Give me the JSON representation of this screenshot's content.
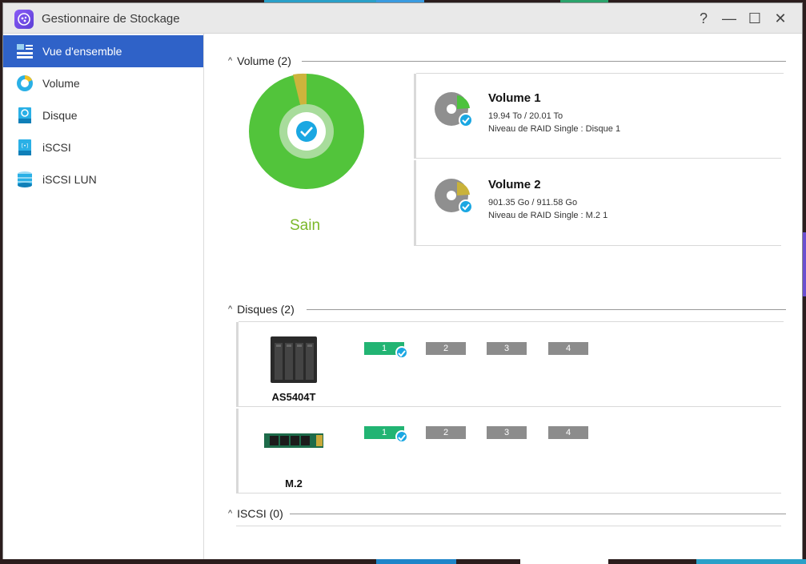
{
  "window": {
    "title": "Gestionnaire de Stockage"
  },
  "titlebar_controls": {
    "help": "?",
    "minimize": "—",
    "maximize": "☐",
    "close": "✕"
  },
  "sidebar": {
    "items": [
      {
        "label": "Vue d'ensemble",
        "icon": "overview-icon",
        "active": true
      },
      {
        "label": "Volume",
        "icon": "volume-icon",
        "active": false
      },
      {
        "label": "Disque",
        "icon": "disk-icon",
        "active": false
      },
      {
        "label": "iSCSI",
        "icon": "iscsi-icon",
        "active": false
      },
      {
        "label": "iSCSI LUN",
        "icon": "iscsi-lun-icon",
        "active": false
      }
    ]
  },
  "volume_section": {
    "title": "Volume (2)",
    "status": "Sain",
    "status_color": "#7bb82a",
    "volumes": [
      {
        "name": "Volume 1",
        "usage": "19.94 To / 20.01 To",
        "raid": "Niveau de RAID Single : Disque 1",
        "used_fraction": 0.9965,
        "pie_color": "#4cc23d"
      },
      {
        "name": "Volume 2",
        "usage": "901.35 Go / 911.58 Go",
        "raid": "Niveau de RAID Single : M.2 1",
        "used_fraction": 0.9888,
        "pie_color": "#c9b23a"
      }
    ]
  },
  "disks_section": {
    "title": "Disques (2)",
    "devices": [
      {
        "name": "AS5404T",
        "bays": [
          "1",
          "2",
          "3",
          "4"
        ],
        "healthy_bay": "1"
      },
      {
        "name": "M.2",
        "bays": [
          "1",
          "2",
          "3",
          "4"
        ],
        "healthy_bay": "1"
      }
    ]
  },
  "iscsi_section": {
    "title": "ISCSI (0)"
  },
  "colors": {
    "accent": "#2f62c8",
    "healthy": "#22b473",
    "check": "#1aa7e2",
    "pie_green": "#52c43b",
    "pie_yellow": "#cdb43c"
  }
}
